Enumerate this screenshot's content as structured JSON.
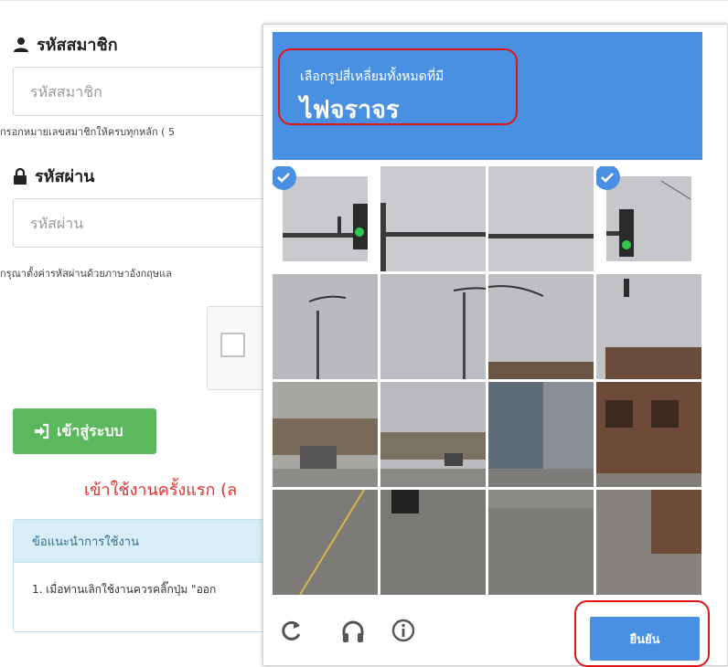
{
  "form": {
    "member_label": "รหัสสมาชิก",
    "member_placeholder": "รหัสสมาชิก",
    "member_help": "กรอกหมายเลขสมาชิกให้ครบทุกหลัก ( 5",
    "password_label": "รหัสผ่าน",
    "password_placeholder": "รหัสผ่าน",
    "password_help": "กรุณาตั้งค่ารหัสผ่านด้วยภาษาอังกฤษแล",
    "login_button": "เข้าสู่ระบบ",
    "first_use": "เข้าใช้งานครั้งแรก (ล",
    "advice_title": "ข้อแนะนำการใช้งาน",
    "advice_item": "1. เมื่อท่านเลิกใช้งานควรคลิ๊กปุ่ม \"ออก"
  },
  "captcha": {
    "instruction": "เลือกรูปสี่เหลี่ยมทั้งหมดที่มี",
    "target": "ไฟจราจร",
    "verify_button": "ยืนยัน",
    "selected_tiles": [
      0,
      3
    ],
    "icons": [
      "reload-icon",
      "audio-icon",
      "info-icon"
    ],
    "accent_color": "#4a90e2",
    "highlight_color": "#e01616"
  },
  "colors": {
    "login_green": "#5cb85c",
    "first_use_red": "#e0312b",
    "advice_bg": "#d9edf7"
  }
}
